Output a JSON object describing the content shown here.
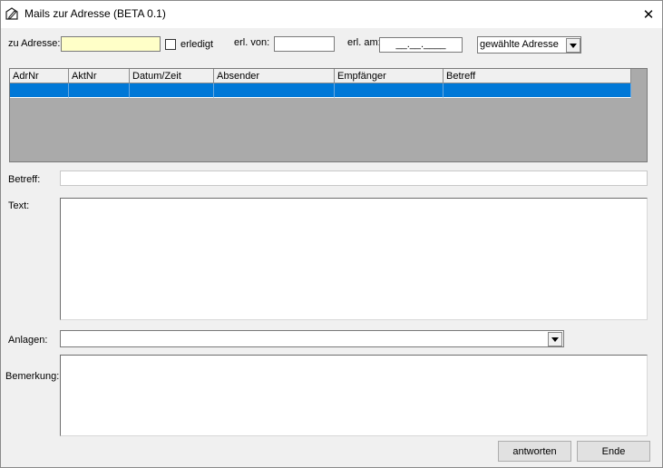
{
  "window": {
    "title": "Mails zur Adresse (BETA 0.1)",
    "icon": "pen-icon",
    "close": "✕"
  },
  "filters": {
    "zu_adresse_label": "zu Adresse:",
    "zu_adresse_value": "",
    "zu_adresse_bg": "#ffffc8",
    "erledigt_label": "erledigt",
    "erledigt_checked": false,
    "erl_von_label": "erl. von:",
    "erl_von_value": "",
    "erl_am_label": "erl. am:",
    "erl_am_value": "__.__.____",
    "scope_selected": "gewählte Adresse"
  },
  "grid": {
    "columns": [
      "AdrNr",
      "AktNr",
      "Datum/Zeit",
      "Absender",
      "Empfänger",
      "Betreff"
    ],
    "selected_row": [
      "",
      "",
      "",
      "",
      "",
      ""
    ],
    "selection_color": "#0078d7",
    "background_color": "#aaaaaa"
  },
  "form": {
    "betreff_label": "Betreff:",
    "betreff_value": "",
    "text_label": "Text:",
    "text_value": "",
    "anlagen_label": "Anlagen:",
    "anlagen_value": "",
    "bemerkung_label": "Bemerkung:",
    "bemerkung_value": ""
  },
  "buttons": {
    "reply": "antworten",
    "end": "Ende"
  }
}
